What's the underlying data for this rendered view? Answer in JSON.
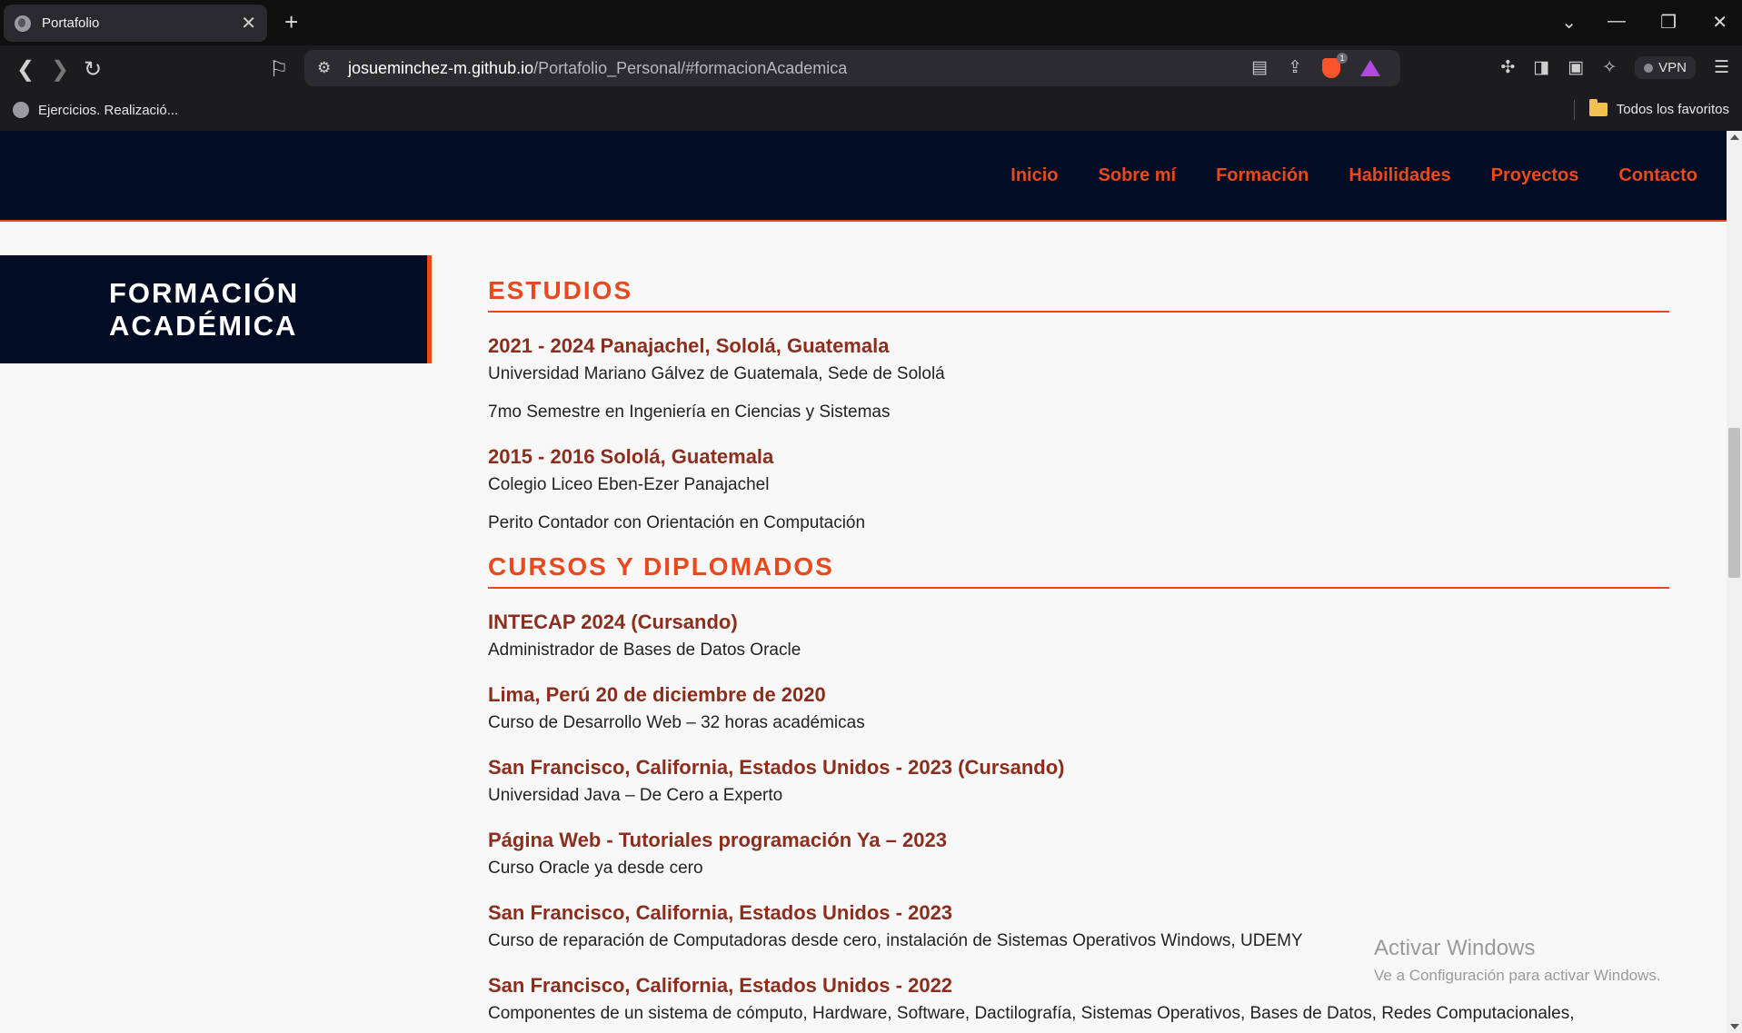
{
  "browser": {
    "tab_title": "Portafolio",
    "url_host": "josueminchez-m.github.io",
    "url_path": "/Portafolio_Personal/#formacionAcademica",
    "shield_count": "1",
    "vpn_label": "VPN",
    "bookmark_item": "Ejercicios. Realizació...",
    "bookmark_folder": "Todos los favoritos"
  },
  "nav": {
    "items": [
      "Inicio",
      "Sobre mí",
      "Formación",
      "Habilidades",
      "Proyectos",
      "Contacto"
    ],
    "color": "#e8491d",
    "background": "#020c24"
  },
  "sidebar": {
    "heading_line1": "FORMACIÓN",
    "heading_line2": "ACADÉMICA"
  },
  "studies": {
    "title": "ESTUDIOS",
    "entries": [
      {
        "heading": "2021 - 2024 Panajachel, Sololá, Guatemala",
        "line1": "Universidad Mariano Gálvez de Guatemala, Sede de Sololá",
        "line2": "7mo Semestre en Ingeniería en Ciencias y Sistemas"
      },
      {
        "heading": "2015 - 2016 Sololá, Guatemala",
        "line1": "Colegio Liceo Eben-Ezer Panajachel",
        "line2": "Perito Contador con Orientación en Computación"
      }
    ]
  },
  "courses": {
    "title": "CURSOS Y DIPLOMADOS",
    "entries": [
      {
        "heading": "INTECAP 2024 (Cursando)",
        "line1": "Administrador de Bases de Datos Oracle"
      },
      {
        "heading": "Lima, Perú 20 de diciembre de 2020",
        "line1": "Curso de Desarrollo Web – 32 horas académicas"
      },
      {
        "heading": "San Francisco, California, Estados Unidos - 2023 (Cursando)",
        "line1": "Universidad Java – De Cero a Experto"
      },
      {
        "heading": "Página Web - Tutoriales programación Ya – 2023",
        "line1": "Curso Oracle ya desde cero"
      },
      {
        "heading": "San Francisco, California, Estados Unidos - 2023",
        "line1": "Curso de reparación de Computadoras desde cero, instalación de Sistemas Operativos Windows, UDEMY"
      },
      {
        "heading": "San Francisco, California, Estados Unidos - 2022",
        "line1": "Componentes de un sistema de cómputo, Hardware, Software, Dactilografía, Sistemas Operativos, Bases de Datos, Redes Computacionales,"
      }
    ]
  },
  "watermark": {
    "line1": "Activar Windows",
    "line2": "Ve a Configuración para activar Windows."
  }
}
